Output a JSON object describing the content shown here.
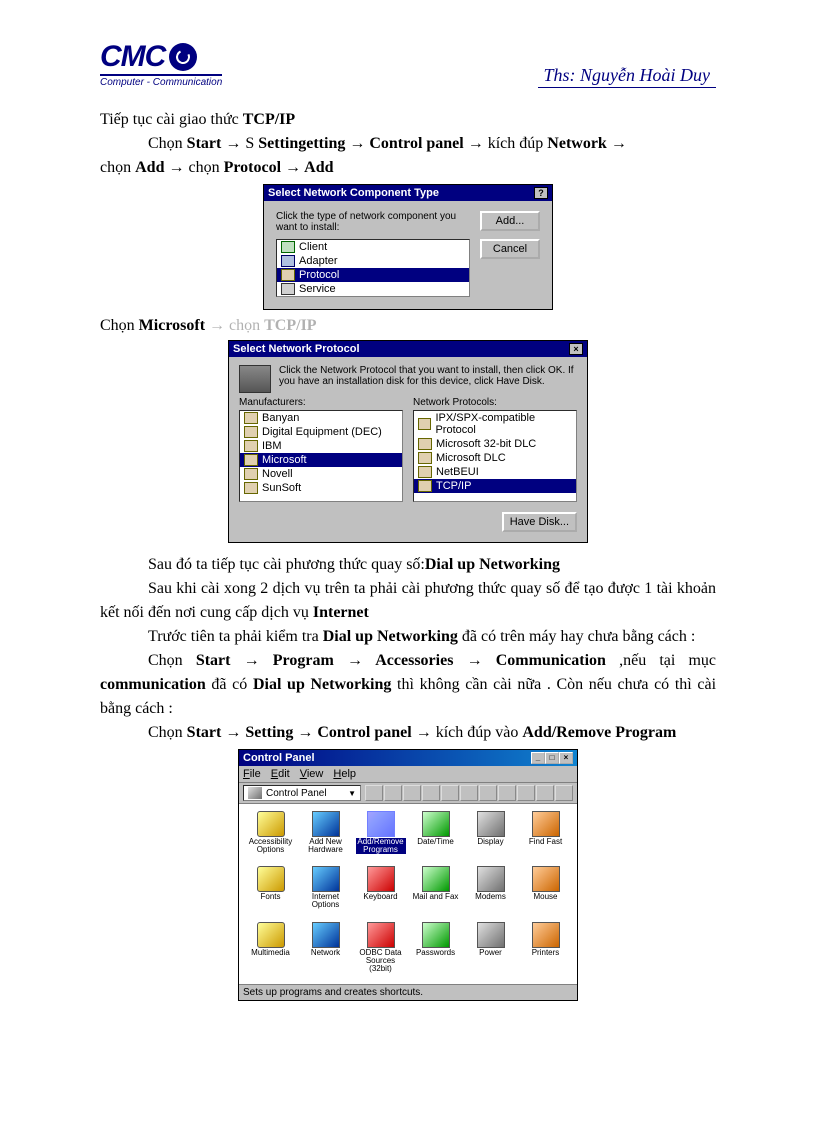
{
  "header": {
    "logo_text": "CMC",
    "logo_sub": "Computer - Communication",
    "author": "Ths: Nguyễn Hoài Duy"
  },
  "para1": {
    "l1a": "Tiếp tục cài giao thức ",
    "l1b": "TCP/IP",
    "l2a": "Chọn ",
    "l2b": "Start",
    "l2c": " Setting",
    "l2d": " Control panel",
    "l2e": " kích đúp ",
    "l2f": "Network",
    "l3a": "chọn ",
    "l3b": "Add",
    "l3c": " chọn ",
    "l3d": "Protocol",
    "l3e": " Add"
  },
  "dialog1": {
    "title": "Select Network Component Type",
    "instr": "Click the type of network component you want to install:",
    "items": [
      "Client",
      "Adapter",
      "Protocol",
      "Service"
    ],
    "selected": 2,
    "btn_add": "Add...",
    "btn_cancel": "Cancel"
  },
  "para2": {
    "a": "Chọn ",
    "b": "Microsoft",
    "c": " → chọn ",
    "d": "TCP/IP"
  },
  "dialog2": {
    "title": "Select Network Protocol",
    "instr": "Click the Network Protocol that you want to install, then click OK. If you have an installation disk for this device, click Have Disk.",
    "col1_label": "Manufacturers:",
    "col1": [
      "Banyan",
      "Digital Equipment (DEC)",
      "IBM",
      "Microsoft",
      "Novell",
      "SunSoft"
    ],
    "col1_sel": 3,
    "col2_label": "Network Protocols:",
    "col2": [
      "IPX/SPX-compatible Protocol",
      "Microsoft 32-bit DLC",
      "Microsoft DLC",
      "NetBEUI",
      "TCP/IP"
    ],
    "col2_sel": 4,
    "btn_disk": "Have Disk..."
  },
  "para3": {
    "l1a": "Sau đó ta tiếp tục cài phương thức quay số:",
    "l1b": "Dial up Networking",
    "l2a": "Sau khi cài xong 2 dịch vụ trên ta phải cài phương thức quay số để tạo được 1 tài khoản kết nối đến nơi cung cấp dịch vụ ",
    "l2b": "Internet",
    "l3a": "Trước tiên ta phải kiểm tra ",
    "l3b": "Dial up Networking",
    "l3c": " đã có trên máy hay chưa bằng cách :",
    "l4a": "Chọn ",
    "l4b": "Start",
    "l4c": " Program",
    "l4d": " Accessories",
    "l4e": " Communication",
    "l4f": " ,nếu tại mục ",
    "l4g": "communication",
    "l4h": " đã có ",
    "l4i": "Dial up Networking",
    "l4j": " thì không cần cài nữa . Còn nếu chưa có thì cài bằng cách :",
    "l5a": "Chọn ",
    "l5b": "Start",
    "l5c": " Setting",
    "l5d": " Control panel",
    "l5e": " kích đúp vào ",
    "l5f": "Add/Remove Program"
  },
  "cp": {
    "title": "Control Panel",
    "menu": [
      "File",
      "Edit",
      "View",
      "Help"
    ],
    "address": "Control Panel",
    "items": [
      "Accessibility Options",
      "Add New Hardware",
      "Add/Remove Programs",
      "Date/Time",
      "Display",
      "Find Fast",
      "Fonts",
      "Internet Options",
      "Keyboard",
      "Mail and Fax",
      "Modems",
      "Mouse",
      "Multimedia",
      "Network",
      "ODBC Data Sources (32bit)",
      "Passwords",
      "Power",
      "Printers"
    ],
    "selected": 2,
    "status": "Sets up programs and creates shortcuts."
  },
  "arrow": "→"
}
